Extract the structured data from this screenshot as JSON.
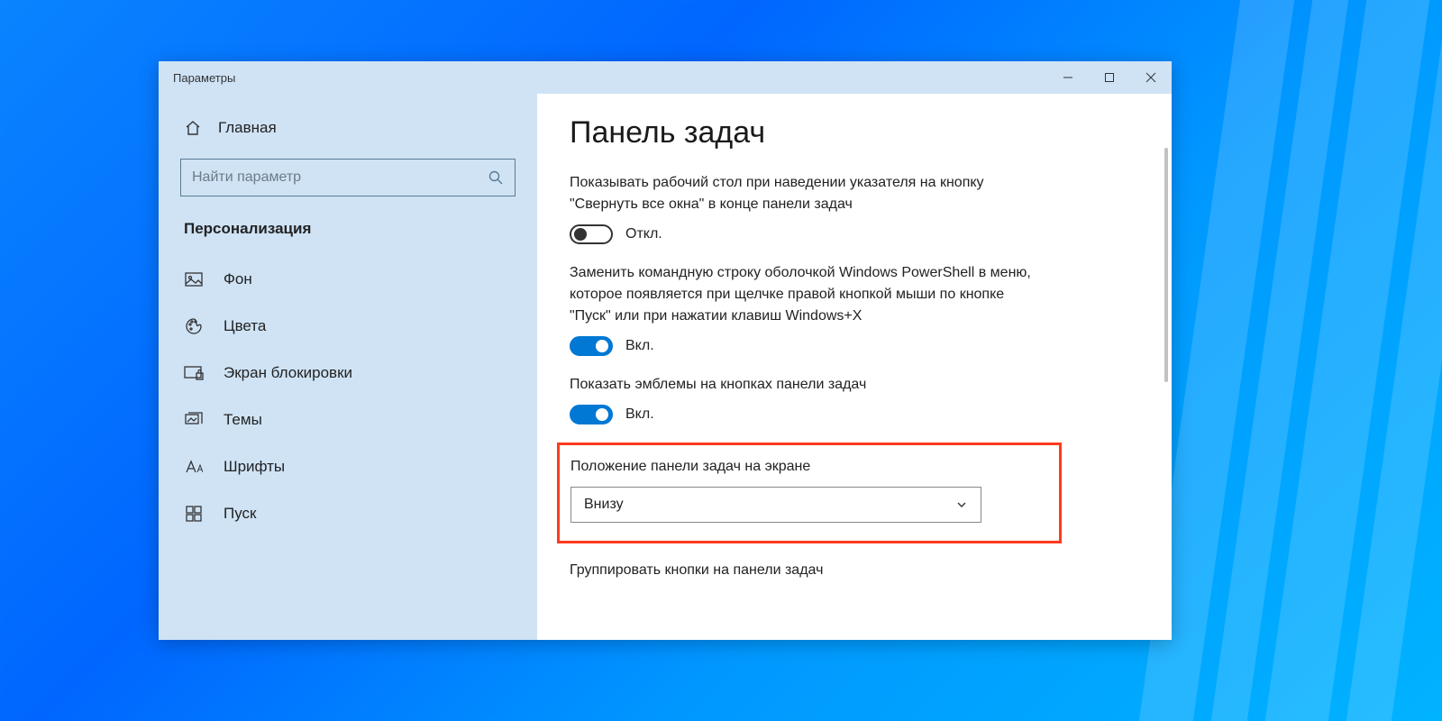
{
  "window": {
    "title": "Параметры"
  },
  "sidebar": {
    "home": "Главная",
    "search_placeholder": "Найти параметр",
    "section": "Персонализация",
    "items": [
      {
        "label": "Фон"
      },
      {
        "label": "Цвета"
      },
      {
        "label": "Экран блокировки"
      },
      {
        "label": "Темы"
      },
      {
        "label": "Шрифты"
      },
      {
        "label": "Пуск"
      }
    ]
  },
  "main": {
    "heading": "Панель задач",
    "peek_desc": "Показывать рабочий стол при наведении указателя на кнопку \"Свернуть все окна\" в конце панели задач",
    "peek_state": "Откл.",
    "powershell_desc": "Заменить командную строку оболочкой Windows PowerShell в меню, которое появляется при щелчке правой кнопкой мыши по кнопке \"Пуск\" или при нажатии клавиш Windows+X",
    "powershell_state": "Вкл.",
    "badges_desc": "Показать эмблемы на кнопках панели задач",
    "badges_state": "Вкл.",
    "position_label": "Положение панели задач на экране",
    "position_value": "Внизу",
    "group_label": "Группировать кнопки на панели задач"
  }
}
